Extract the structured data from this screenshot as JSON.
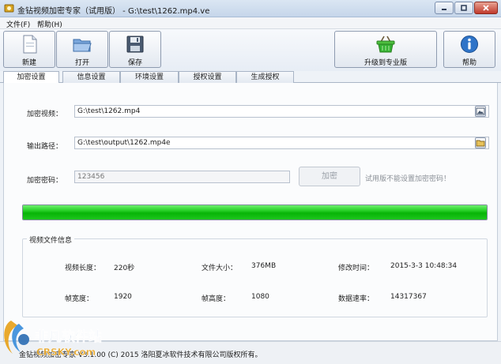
{
  "window": {
    "title": "金钻视频加密专家（试用版） - G:\\test\\1262.mp4.ve"
  },
  "menu": {
    "file": "文件(F)",
    "help": "帮助(H)"
  },
  "toolbar": {
    "new_label": "新建",
    "open_label": "打开",
    "save_label": "保存",
    "upgrade_label": "升级到专业版",
    "help_label": "帮助"
  },
  "tabs": [
    {
      "label": "加密设置",
      "active": true
    },
    {
      "label": "信息设置",
      "active": false
    },
    {
      "label": "环境设置",
      "active": false
    },
    {
      "label": "授权设置",
      "active": false
    },
    {
      "label": "生成授权",
      "active": false
    }
  ],
  "form": {
    "video_label": "加密视频：",
    "video_value": "G:\\test\\1262.mp4",
    "output_label": "输出路径：",
    "output_value": "G:\\test\\output\\1262.mp4e",
    "password_label": "加密密码：",
    "password_value": "123456",
    "encrypt_button": "加密",
    "trial_note": "试用版不能设置加密密码！"
  },
  "progress": {
    "fraction": 1.0
  },
  "info": {
    "title": "视频文件信息",
    "duration_label": "视频长度：",
    "duration_value": "220秒",
    "filesize_label": "文件大小：",
    "filesize_value": "376MB",
    "modified_label": "修改时间：",
    "modified_value": "2015-3-3 10:48:34",
    "width_label": "帧宽度：",
    "width_value": "1920",
    "height_label": "帧高度：",
    "height_value": "1080",
    "bitrate_label": "数据速率：",
    "bitrate_value": "14317367"
  },
  "status": {
    "text": "金钻视频加密专家 V3.1.00 (C) 2015 洛阳夏冰软件技术有限公司版权所有。"
  },
  "watermark": {
    "brand": "非凡软件站",
    "domain": "CRSKY.com"
  },
  "icons": {
    "app": "app-icon",
    "new": "new-file-icon",
    "open": "open-folder-icon",
    "save": "floppy-disk-icon",
    "upgrade": "shopping-basket-icon",
    "help": "info-icon",
    "browse_video": "picture-browse-icon",
    "browse_output": "folder-browse-icon"
  },
  "colors": {
    "progress": "#07b407",
    "close_button": "#c0392b",
    "help_icon": "#2f74c8",
    "upgrade_icon": "#34b233"
  }
}
